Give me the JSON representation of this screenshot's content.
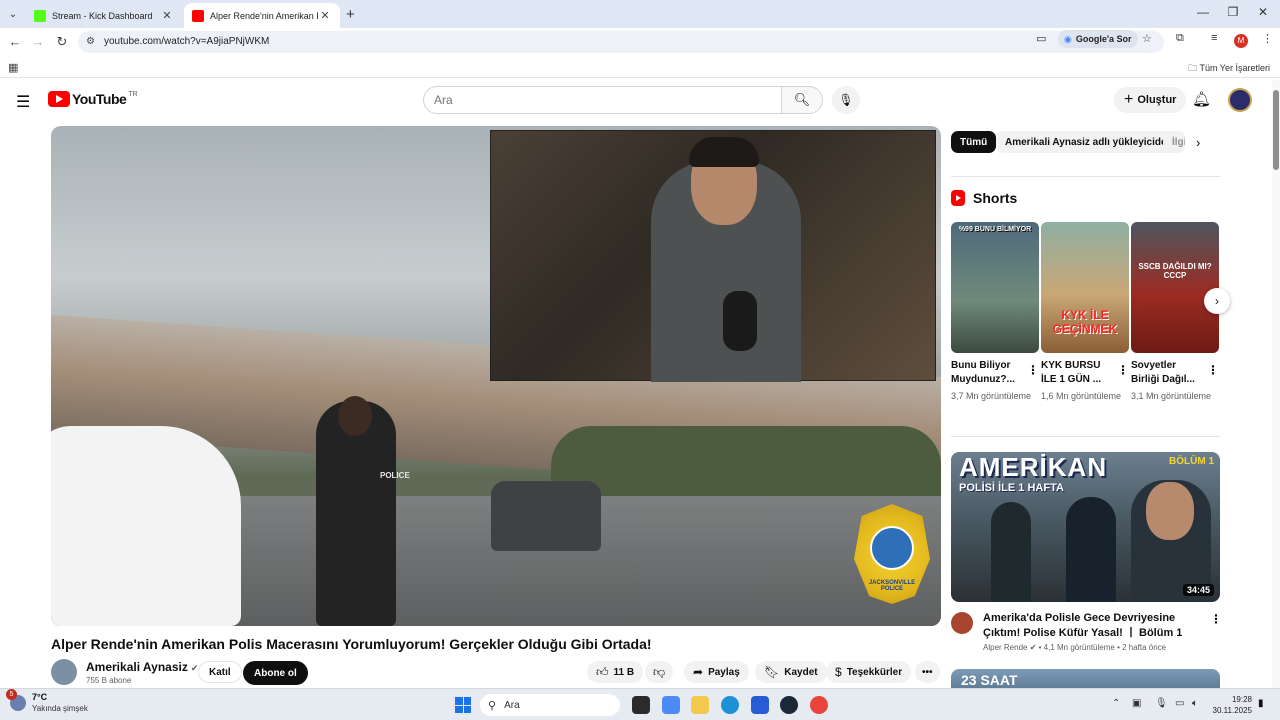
{
  "browser": {
    "tabs": [
      {
        "title": "Stream - Kick Dashboard",
        "favicon_color": "#53fc18",
        "active": false
      },
      {
        "title": "Alper Rende'nin Amerikan Polis",
        "favicon_color": "#ff0000",
        "active": true
      }
    ],
    "url": "youtube.com/watch?v=A9jiaPNjWKM",
    "google_ask_label": "Google'a Sor",
    "profile_initial": "M",
    "bookmarks_label": "Tüm Yer İşaretleri"
  },
  "youtube": {
    "logo_text": "YouTube",
    "country_code": "TR",
    "search_placeholder": "Ara",
    "create_label": "Oluştur"
  },
  "video": {
    "title": "Alper Rende'nin Amerikan Polis Macerasını Yorumluyorum! Gerçekler Olduğu Gibi Ortada!",
    "overlay_text": "POLICE",
    "badge_text": "JACKSONVILLE POLICE",
    "channel": {
      "name": "Amerikali Aynasiz",
      "subscribers": "755 B abone",
      "join_label": "Katıl",
      "subscribe_label": "Abone ol"
    },
    "actions": {
      "likes": "11 B",
      "share_label": "Paylaş",
      "save_label": "Kaydet",
      "thanks_label": "Teşekkürler"
    }
  },
  "sidebar": {
    "chips": [
      {
        "label": "Tümü",
        "active": true
      },
      {
        "label": "Amerikali Aynasiz adlı yükleyiciden",
        "active": false
      },
      {
        "label": "İlgi",
        "active": false
      }
    ],
    "shorts_heading": "Shorts",
    "shorts": [
      {
        "title": "Bunu Biliyor Muydunuz?...",
        "views": "3,7 Mn görüntüleme",
        "overlay": "%99 BUNU BİLMİYOR",
        "bg": "#5b7a8c"
      },
      {
        "title": "KYK BURSU İLE 1 GÜN ...",
        "views": "1,6 Mn görüntüleme",
        "overlay": "KYK İLE GEÇİNMEK",
        "bg": "#6a8a6f"
      },
      {
        "title": "Sovyetler Birliği Dağıl...",
        "views": "3,1 Mn görüntüleme",
        "overlay": "SSCB DAĞILDI MI? СССР",
        "bg": "#7b2a24"
      }
    ],
    "recommended": {
      "thumb_title": "AMERİKAN",
      "thumb_subtitle": "POLİSİ İLE 1 HAFTA",
      "thumb_episode": "BÖLÜM 1",
      "duration": "34:45",
      "title": "Amerika'da Polisle Gece Devriyesine Çıktım! Polise Küfür Yasal! ㅣ Bölüm 1",
      "channel": "Alper Rende",
      "views": "4,1 Mn görüntüleme",
      "age": "2 hafta önce",
      "next_thumb_text": "23 SAAT"
    }
  },
  "taskbar": {
    "weather_temp": "7°C",
    "weather_condition": "Yakında şimşek",
    "weather_badge": "5",
    "search_placeholder": "Ara",
    "time": "19:28",
    "date": "30.11.2025"
  }
}
